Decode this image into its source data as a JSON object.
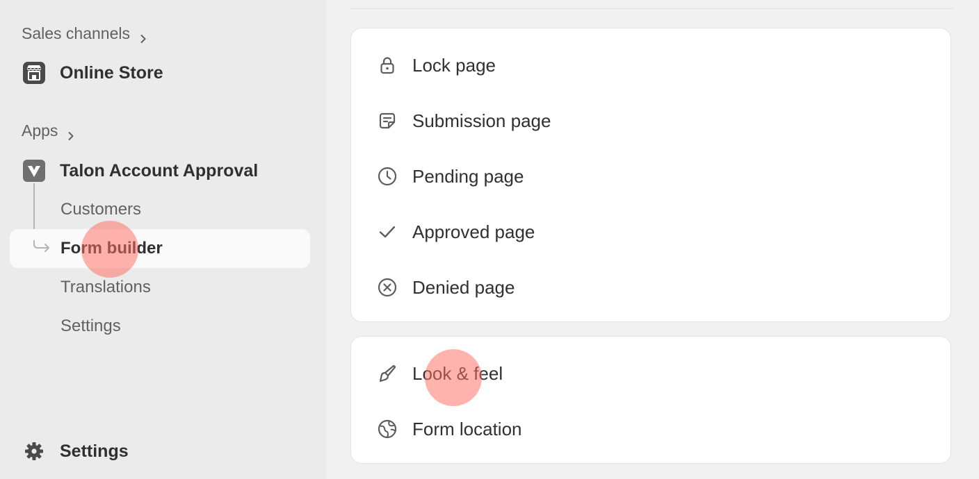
{
  "sidebar": {
    "sales_channels_label": "Sales channels",
    "online_store_label": "Online Store",
    "apps_label": "Apps",
    "app_name": "Talon Account Approval",
    "subnav": [
      {
        "label": "Customers",
        "active": false
      },
      {
        "label": "Form builder",
        "active": true
      },
      {
        "label": "Translations",
        "active": false
      },
      {
        "label": "Settings",
        "active": false
      }
    ],
    "settings_label": "Settings",
    "icons": {
      "sales_channels": "chevron-right-icon",
      "online_store": "storefront-icon",
      "apps": "chevron-right-icon",
      "app": "talon-logo-icon",
      "settings": "gear-icon"
    }
  },
  "main": {
    "pages_card": [
      {
        "label": "Lock page",
        "icon": "lock-icon"
      },
      {
        "label": "Submission page",
        "icon": "note-icon"
      },
      {
        "label": "Pending page",
        "icon": "clock-icon"
      },
      {
        "label": "Approved page",
        "icon": "checkmark-icon"
      },
      {
        "label": "Denied page",
        "icon": "x-circle-icon"
      }
    ],
    "settings_card": [
      {
        "label": "Look & feel",
        "icon": "paintbrush-icon"
      },
      {
        "label": "Form location",
        "icon": "globe-icon"
      }
    ]
  },
  "colors": {
    "sidebar_bg": "#ebebeb",
    "content_bg": "#f1f1f1",
    "card_bg": "#ffffff",
    "text_primary": "#303030",
    "text_secondary": "#616161",
    "click_marker": "#ff6e5f"
  }
}
